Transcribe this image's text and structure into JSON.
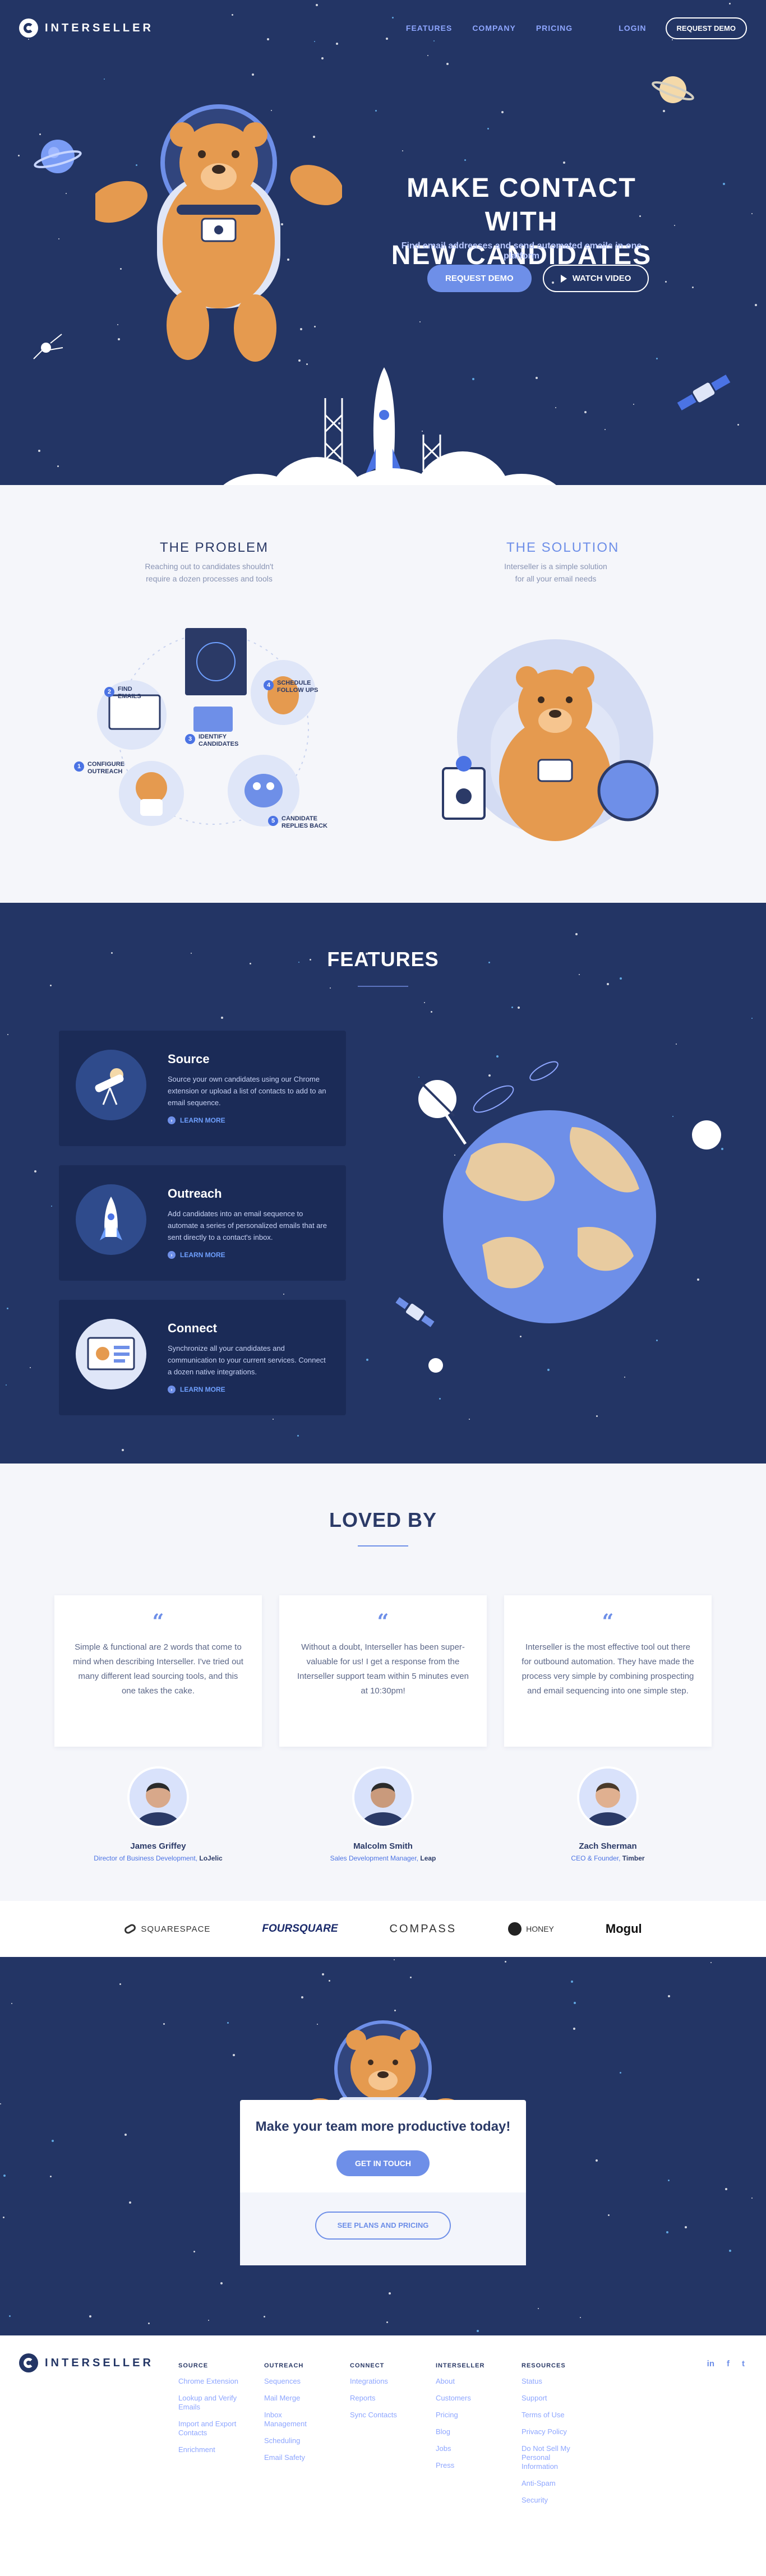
{
  "brand": {
    "name": "INTERSELLER"
  },
  "nav": {
    "links": [
      "FEATURES",
      "COMPANY",
      "PRICING"
    ],
    "login": "LOGIN",
    "request_demo": "REQUEST DEMO"
  },
  "hero": {
    "title_line1": "MAKE CONTACT WITH",
    "title_line2": "NEW CANDIDATES",
    "subtitle": "Find email addresses and send automated emails in one platform",
    "btn_demo": "REQUEST DEMO",
    "btn_video": "WATCH VIDEO"
  },
  "problem": {
    "title": "THE PROBLEM",
    "text_line1": "Reaching out to candidates shouldn't",
    "text_line2": "require a dozen processes and tools",
    "steps": [
      {
        "num": "1",
        "label": "CONFIGURE OUTREACH"
      },
      {
        "num": "2",
        "label": "FIND EMAILS"
      },
      {
        "num": "3",
        "label": "IDENTIFY CANDIDATES"
      },
      {
        "num": "4",
        "label": "SCHEDULE FOLLOW UPS"
      },
      {
        "num": "5",
        "label": "CANDIDATE REPLIES BACK"
      }
    ]
  },
  "solution": {
    "title": "THE SOLUTION",
    "text_line1": "Interseller is a simple solution",
    "text_line2": "for all your email needs"
  },
  "features": {
    "title": "FEATURES",
    "learn_more": "LEARN MORE",
    "items": [
      {
        "title": "Source",
        "text": "Source your own candidates using our Chrome extension or upload a list of contacts to add to an email sequence."
      },
      {
        "title": "Outreach",
        "text": "Add candidates into an email sequence to automate a series of personalized emails that are sent directly to a contact's inbox."
      },
      {
        "title": "Connect",
        "text": "Synchronize all your candidates and communication to your current services. Connect a dozen native integrations."
      }
    ]
  },
  "loved": {
    "title": "LOVED BY",
    "quote_mark": "“",
    "testimonials": [
      {
        "quote": "Simple & functional are 2 words that come to mind when describing Interseller. I've tried out many different lead sourcing tools, and this one takes the cake.",
        "name": "James Griffey",
        "role": "Director of Business Development,",
        "company": "LoJelic"
      },
      {
        "quote": "Without a doubt, Interseller has been super-valuable for us! I get a response from the Interseller support team within 5 minutes even at 10:30pm!",
        "name": "Malcolm Smith",
        "role": "Sales Development Manager,",
        "company": "Leap"
      },
      {
        "quote": "Interseller is the most effective tool out there for outbound automation. They have made the process very simple by combining prospecting and email sequencing into one simple step.",
        "name": "Zach Sherman",
        "role": "CEO & Founder,",
        "company": "Timber"
      }
    ]
  },
  "logos": [
    "SQUARESPACE",
    "FOURSQUARE",
    "COMPASS",
    "HONEY",
    "Mogul"
  ],
  "cta": {
    "title": "Make your team more productive today!",
    "get_in_touch": "GET IN TOUCH",
    "see_plans": "SEE PLANS AND PRICING"
  },
  "footer": {
    "columns": [
      {
        "title": "SOURCE",
        "links": [
          "Chrome Extension",
          "Lookup and Verify Emails",
          "Import and Export Contacts",
          "Enrichment"
        ]
      },
      {
        "title": "OUTREACH",
        "links": [
          "Sequences",
          "Mail Merge",
          "Inbox Management",
          "Scheduling",
          "Email Safety"
        ]
      },
      {
        "title": "CONNECT",
        "links": [
          "Integrations",
          "Reports",
          "Sync Contacts"
        ]
      },
      {
        "title": "INTERSELLER",
        "links": [
          "About",
          "Customers",
          "Pricing",
          "Blog",
          "Jobs",
          "Press"
        ]
      },
      {
        "title": "RESOURCES",
        "links": [
          "Status",
          "Support",
          "Terms of Use",
          "Privacy Policy",
          "Do Not Sell My Personal Information",
          "Anti-Spam",
          "Security"
        ]
      }
    ],
    "social": [
      "in",
      "f",
      "t"
    ]
  },
  "colors": {
    "navy": "#233565",
    "accent": "#6e8fe8",
    "bear": "#e59a4f"
  }
}
